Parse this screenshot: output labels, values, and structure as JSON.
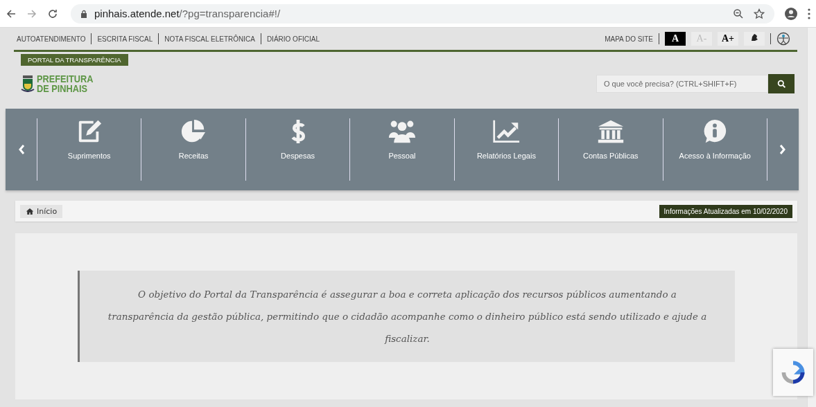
{
  "browser": {
    "url_host": "pinhais.atende.net",
    "url_path": "/?pg=transparencia#!/"
  },
  "top_links": [
    "AUTOATENDIMENTO",
    "ESCRITA FISCAL",
    "NOTA FISCAL ELETRÔNICA",
    "DIÁRIO OFICIAL"
  ],
  "site_map": "MAPA DO SITE",
  "font_controls": [
    {
      "label": "A",
      "kind": "contrast"
    },
    {
      "label": "A-",
      "kind": "smaller"
    },
    {
      "label": "A+",
      "kind": "larger"
    }
  ],
  "portal_tag": "PORTAL DA TRANSPARÊNCIA",
  "logo": {
    "line_1": "PREFEITURA",
    "line_2": "DE PINHAIS"
  },
  "search": {
    "placeholder": "O que você precisa? (CTRL+SHIFT+F)"
  },
  "nav_items": [
    {
      "label": "Suprimentos"
    },
    {
      "label": "Receitas"
    },
    {
      "label": "Despesas"
    },
    {
      "label": "Pessoal"
    },
    {
      "label": "Relatórios Legais"
    },
    {
      "label": "Contas Públicas"
    },
    {
      "label": "Acesso à Informação"
    }
  ],
  "breadcrumb": "Início",
  "updated_badge": "Informações Atualizadas em 10/02/2020",
  "quote": "O objetivo do Portal da Transparência é assegurar a boa e correta aplicação dos recursos públicos aumentando a transparência da gestão pública, permitindo que o cidadão acompanhe como o dinheiro público está sendo utilizado e ajude a fiscalizar."
}
